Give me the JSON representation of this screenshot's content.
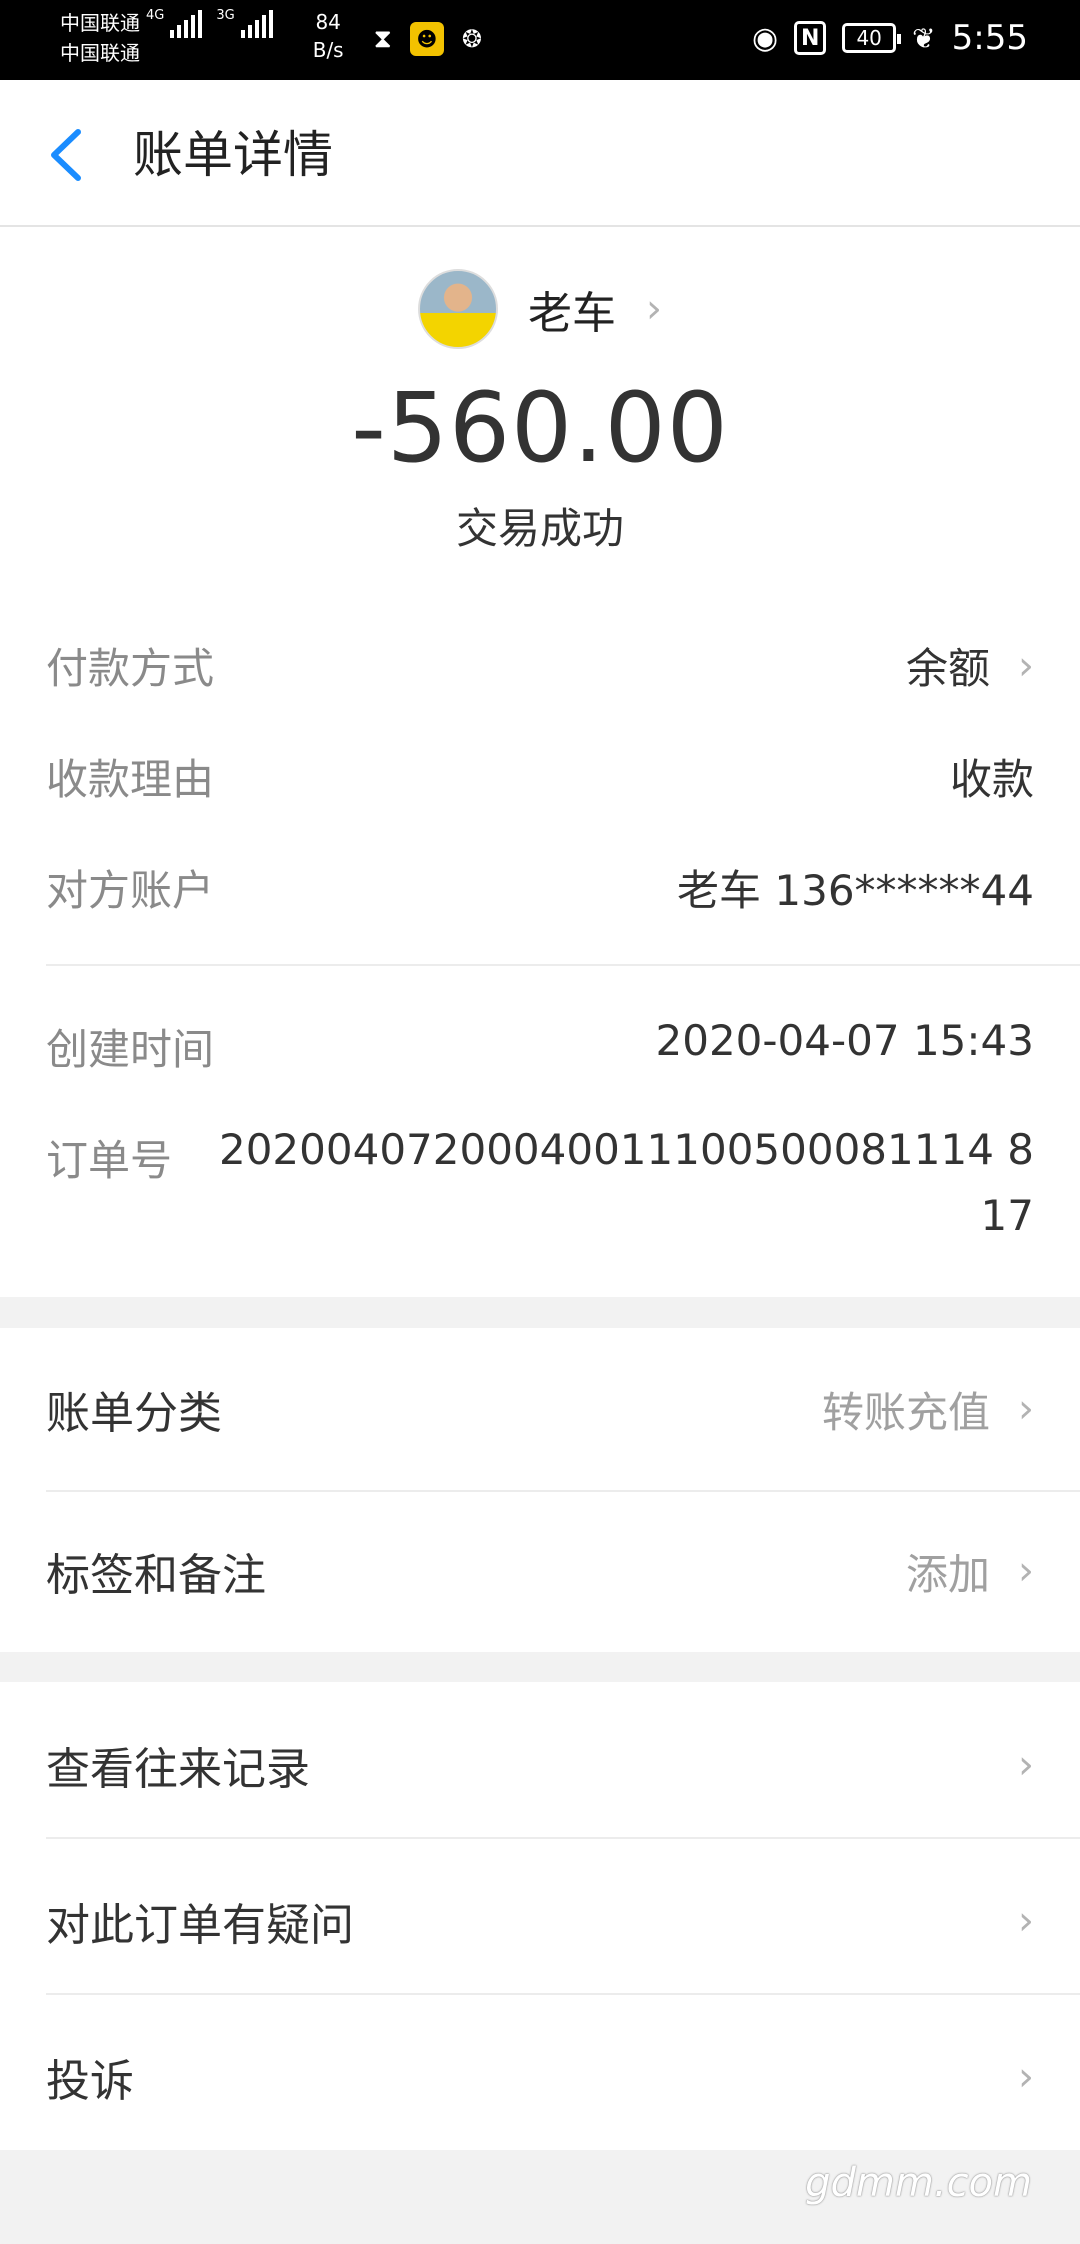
{
  "status_bar": {
    "carrier1": "中国联通",
    "carrier2": "中国联通",
    "net1": "4G",
    "net2": "3G",
    "speed_value": "84",
    "speed_unit": "B/s",
    "battery": "40",
    "time": "5:55"
  },
  "header": {
    "title": "账单详情"
  },
  "payee": {
    "name": "老车"
  },
  "amount": "-560.00",
  "status": "交易成功",
  "details": [
    {
      "label": "付款方式",
      "value": "余额"
    },
    {
      "label": "收款理由",
      "value": "收款"
    },
    {
      "label": "对方账户",
      "value": "老车 136******44"
    },
    {
      "label": "创建时间",
      "value": "2020-04-07 15:43"
    },
    {
      "label": "订单号",
      "value_line1": "20200407200040011100500081114 8",
      "value_line2": "17"
    }
  ],
  "category": {
    "label": "账单分类",
    "value": "转账充值"
  },
  "tags": {
    "label": "标签和备注",
    "value": "添加"
  },
  "actions": [
    {
      "label": "查看往来记录"
    },
    {
      "label": "对此订单有疑问"
    },
    {
      "label": "投诉"
    }
  ],
  "watermark": "gdmm.com",
  "colors": {
    "accent": "#1a8cff",
    "hint": "#a0a0a0",
    "label": "#8a8a8a"
  }
}
